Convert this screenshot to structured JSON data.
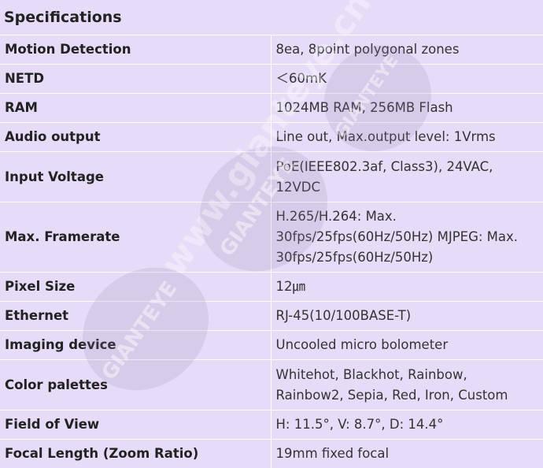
{
  "section_title": "Specifications",
  "rows": [
    {
      "key": "Motion Detection",
      "value": "8ea, 8point polygonal zones",
      "size": "h36"
    },
    {
      "key": "NETD",
      "value": "＜60mK",
      "size": "h36"
    },
    {
      "key": "RAM",
      "value": "1024MB RAM, 256MB Flash",
      "size": "h36"
    },
    {
      "key": "Audio output",
      "value": "Line out, Max.output level: 1Vrms",
      "size": "h36"
    },
    {
      "key": "Input Voltage",
      "value": "PoE(IEEE802.3af, Class3), 24VAC, 12VDC",
      "size": "h64"
    },
    {
      "key": "Max. Framerate",
      "value": "H.265/H.264: Max. 30fps/25fps(60Hz/50Hz) MJPEG: Max. 30fps/25fps(60Hz/50Hz)",
      "size": "h88"
    },
    {
      "key": "Pixel Size",
      "value": "12㎛",
      "size": "h36"
    },
    {
      "key": "Ethernet",
      "value": "RJ-45(10/100BASE-T)",
      "size": "h36"
    },
    {
      "key": "Imaging device",
      "value": "Uncooled micro bolometer",
      "size": "h36"
    },
    {
      "key": "Color palettes",
      "value": "Whitehot, Blackhot, Rainbow, Rainbow2, Sepia, Red, Iron, Custom",
      "size": "h64"
    },
    {
      "key": "Field of View",
      "value": "H: 11.5°, V: 8.7°, D: 14.4°",
      "size": "h36"
    },
    {
      "key": "Focal Length (Zoom Ratio)",
      "value": "19mm fixed focal",
      "size": "h36"
    }
  ],
  "watermark": {
    "brand": "GIANTEYE",
    "url": "www.gianteye.cn"
  }
}
